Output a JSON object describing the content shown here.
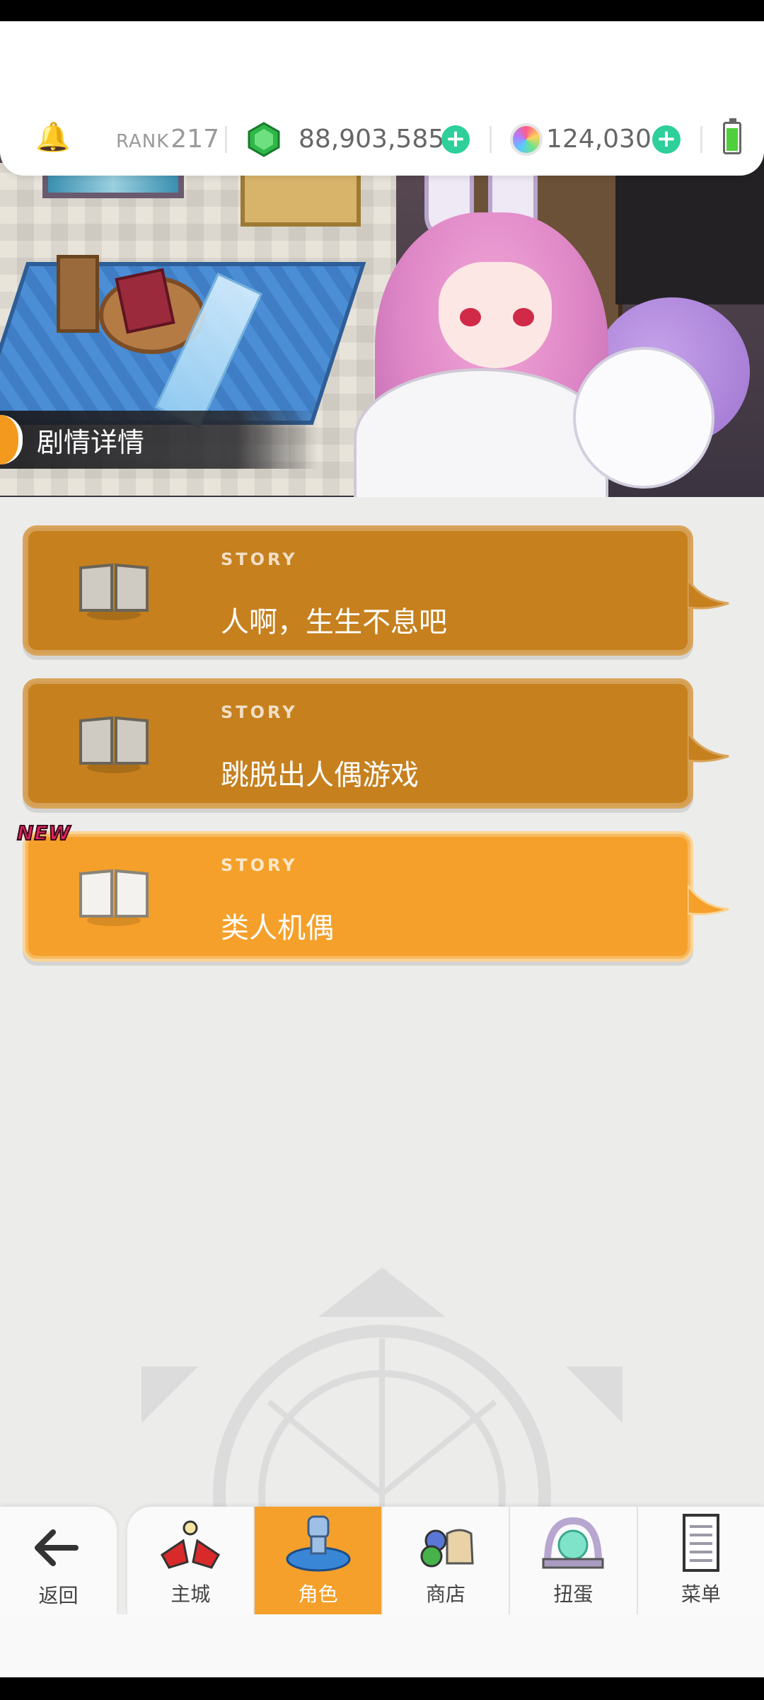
{
  "header": {
    "rank_label": "RANK",
    "rank_value": "217",
    "gems": "88,903,585",
    "orbs": "124,030"
  },
  "banner": {
    "section_label": "剧情详情"
  },
  "stories": [
    {
      "kicker": "STORY",
      "title": "人啊，生生不息吧",
      "state": "read"
    },
    {
      "kicker": "STORY",
      "title": "跳脱出人偶游戏",
      "state": "read"
    },
    {
      "kicker": "STORY",
      "title": "类人机偶",
      "state": "new"
    }
  ],
  "new_badge": "NEW",
  "nav": {
    "back": "返回",
    "items": [
      "主城",
      "角色",
      "商店",
      "扭蛋",
      "菜单"
    ],
    "active": "角色"
  },
  "colors": {
    "card_read": "#c6801e",
    "card_new": "#f5a02a",
    "plus_button": "#2ecf9a",
    "nav_active": "#f5a02a"
  },
  "icons": [
    "bell-icon",
    "green-gem-icon",
    "plus-icon",
    "rainbow-orb-icon",
    "battery-icon",
    "book-icon",
    "back-arrow-icon",
    "town-icon",
    "character-icon",
    "shop-icon",
    "gacha-icon",
    "menu-icon"
  ]
}
